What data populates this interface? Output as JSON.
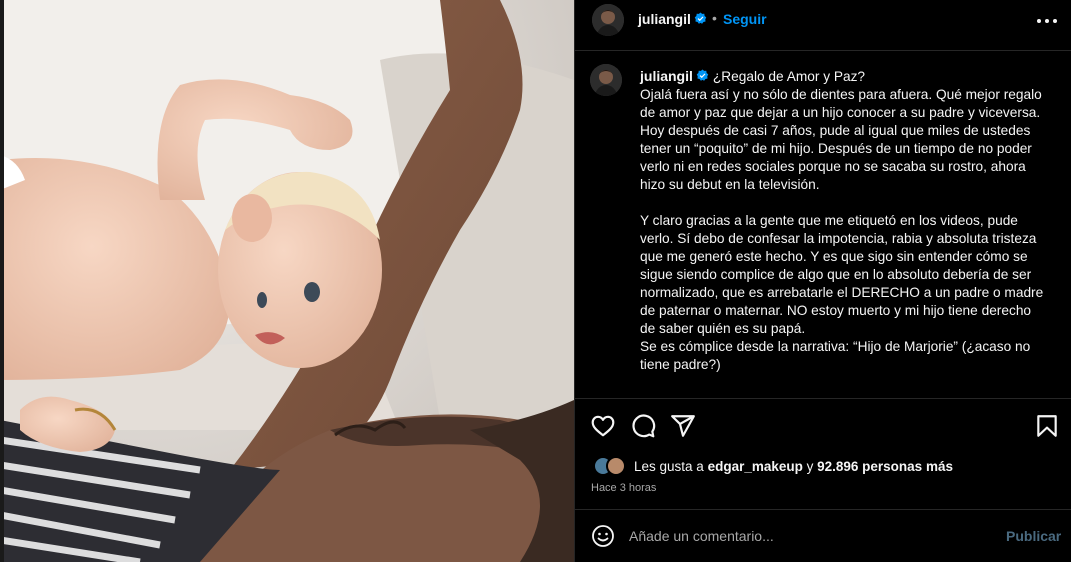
{
  "post": {
    "username": "juliangil",
    "verified": true,
    "separator": "•",
    "follow_label": "Seguir",
    "more_icon": "more-horizontal-icon"
  },
  "caption": {
    "username": "juliangil",
    "text": "¿Regalo de Amor y Paz?\nOjalá fuera así y no sólo de dientes para afuera. Qué mejor regalo de amor y paz que dejar a un hijo conocer a su padre y viceversa.\nHoy después de casi 7 años, pude al igual que miles de ustedes tener un “poquito” de mi hijo. Después de un tiempo de no poder verlo ni en redes sociales porque no se sacaba su rostro, ahora hizo su debut en la televisión.\n\nY claro gracias a la gente que me etiquetó en los videos, pude verlo. Sí debo de confesar la impotencia, rabia y absoluta tristeza que me generó este hecho. Y es que sigo sin entender cómo se sigue siendo complice de algo que en lo absoluto debería de ser normalizado, que es arrebatarle el DERECHO a un padre o madre de paternar o maternar. NO estoy muerto y mi hijo tiene derecho de saber quién es su papá.\nSe es cómplice desde la narrativa: “Hijo de Marjorie” (¿acaso no tiene padre?)"
  },
  "actions": {
    "like_icon": "heart-icon",
    "comment_icon": "comment-icon",
    "share_icon": "send-icon",
    "save_icon": "bookmark-icon"
  },
  "likes": {
    "prefix": "Les gusta a ",
    "user": "edgar_makeup",
    "middle": " y ",
    "count": "92.896 personas más"
  },
  "time_ago": "Hace 3 horas",
  "comment_box": {
    "placeholder": "Añade un comentario...",
    "publish_label": "Publicar",
    "emoji_icon": "emoji-icon"
  },
  "colors": {
    "background": "#000000",
    "text": "#f5f5f5",
    "muted": "#a8a8a8",
    "accent": "#0095f6",
    "verified": "#0095f6",
    "divider": "#262626"
  }
}
